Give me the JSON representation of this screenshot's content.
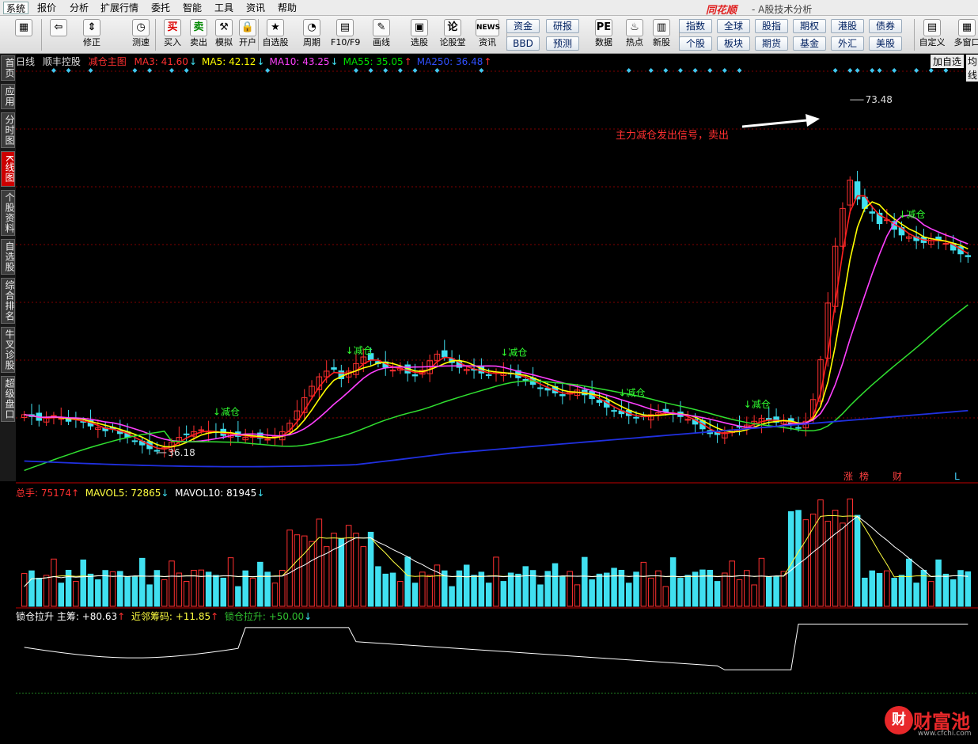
{
  "menu": {
    "items": [
      "系统",
      "报价",
      "分析",
      "扩展行情",
      "委托",
      "智能",
      "工具",
      "资讯",
      "帮助"
    ],
    "brand": "同花顺",
    "subtitle": "- A股技术分析"
  },
  "toolbar": {
    "buttons": [
      {
        "label": "",
        "icon": "grid-icon"
      },
      {
        "label": "",
        "icon": "back-arrow-icon"
      },
      {
        "label": "修正",
        "icon": "updown-arrow-icon"
      },
      {
        "label": "测速",
        "icon": "clock-icon"
      },
      {
        "label": "买入",
        "icon": "buy-icon",
        "glyph": "买"
      },
      {
        "label": "卖出",
        "icon": "sell-icon",
        "glyph": "卖"
      },
      {
        "label": "模拟",
        "icon": "hammer-icon"
      },
      {
        "label": "开户",
        "icon": "lock-icon"
      },
      {
        "label": "自选股",
        "icon": "star-icon"
      },
      {
        "label": "周期",
        "icon": "cycle-icon"
      },
      {
        "label": "F10/F9",
        "icon": "f10-icon"
      },
      {
        "label": "画线",
        "icon": "pen-icon"
      },
      {
        "label": "选股",
        "icon": "monitor-icon"
      },
      {
        "label": "论股堂",
        "icon": "forum-icon"
      },
      {
        "label": "资讯",
        "icon": "news-icon",
        "glyph": "NEWS"
      },
      {
        "label": "数据",
        "icon": "pe-icon",
        "glyph": "PE"
      },
      {
        "label": "热点",
        "icon": "hot-icon"
      },
      {
        "label": "新股",
        "icon": "ipo-icon"
      },
      {
        "label": "自定义",
        "icon": "custom-icon"
      },
      {
        "label": "多窗口",
        "icon": "multiwindow-icon"
      }
    ],
    "grid_buttons": [
      "资金",
      "研报",
      "BBD",
      "预测",
      "指数",
      "全球",
      "股指",
      "期权",
      "港股",
      "债券",
      "个股",
      "板块",
      "期货",
      "基金",
      "外汇",
      "美股"
    ]
  },
  "sidebar": {
    "tabs": [
      "首页",
      "应用",
      "分时图",
      "K线图",
      "个股资料",
      "自选股",
      "综合排名",
      "牛叉诊股",
      "超级盘口"
    ],
    "active": 3
  },
  "price_panel": {
    "period": "日线",
    "stock": "顺丰控股",
    "mode": "减仓主图",
    "ma": [
      {
        "name": "MA3",
        "value": "41.60",
        "arrow": "↓",
        "color": "#ff3030"
      },
      {
        "name": "MA5",
        "value": "42.12",
        "arrow": "↓",
        "color": "#ffff00"
      },
      {
        "name": "MA10",
        "value": "43.25",
        "arrow": "↓",
        "color": "#ff40ff"
      },
      {
        "name": "MA55",
        "value": "35.05",
        "arrow": "↑",
        "color": "#00e000"
      },
      {
        "name": "MA250",
        "value": "36.48",
        "arrow": "↑",
        "color": "#3050ff"
      }
    ],
    "add_select": "加自选",
    "avg_tab": "均线",
    "high_label": "73.48",
    "low_label": "36.18",
    "signal_text": "↓减仓",
    "annotation": "主力减仓发出信号，卖出",
    "event_flags": [
      "涨",
      "榜",
      "财",
      "L"
    ]
  },
  "volume_panel": {
    "label": "总手",
    "value": "75174",
    "arrow": "↑",
    "mavol5_label": "MAVOL5",
    "mavol5": "72865",
    "mavol5_arrow": "↓",
    "mavol10_label": "MAVOL10",
    "mavol10": "81945",
    "mavol10_arrow": "↓"
  },
  "indicator_panel": {
    "name": "锁仓拉升",
    "main_label": "主筹",
    "main": "+80.63",
    "main_arrow": "↑",
    "near_label": "近邻筹码",
    "near": "+11.85",
    "near_arrow": "↑",
    "lock_label": "锁仓拉升",
    "lock": "+50.00",
    "lock_arrow": "↓"
  },
  "watermark": {
    "name": "财富池",
    "url": "www.cfchi.com",
    "glyph": "财"
  },
  "colors": {
    "up": "#ff3030",
    "down": "#40e0f0",
    "ma3": "#ff2020",
    "ma5": "#ffff00",
    "ma10": "#ff40ff",
    "ma55": "#30e030",
    "ma250": "#2030e0",
    "signal": "#30ff30"
  },
  "chart_data": {
    "type": "candlestick",
    "stock": "顺丰控股",
    "ylim": [
      34,
      75
    ],
    "close": [
      40.2,
      40.0,
      39.6,
      39.9,
      40.1,
      39.8,
      39.5,
      39.7,
      39.4,
      39.0,
      38.8,
      38.5,
      38.7,
      38.2,
      37.8,
      37.4,
      37.0,
      36.6,
      36.4,
      36.7,
      37.3,
      37.8,
      38.1,
      38.4,
      38.6,
      38.4,
      38.3,
      38.0,
      38.2,
      37.9,
      37.8,
      37.9,
      37.7,
      37.6,
      37.9,
      38.4,
      39.3,
      40.6,
      42.0,
      43.2,
      44.2,
      44.8,
      45.0,
      44.0,
      44.8,
      45.6,
      46.3,
      46.0,
      45.6,
      45.2,
      44.9,
      45.1,
      44.6,
      44.3,
      44.9,
      45.9,
      46.6,
      46.3,
      45.7,
      45.2,
      45.0,
      44.9,
      44.6,
      44.4,
      44.7,
      44.6,
      44.5,
      44.1,
      43.9,
      43.4,
      43.0,
      42.8,
      42.5,
      42.2,
      42.6,
      42.8,
      42.3,
      41.9,
      41.5,
      41.0,
      40.6,
      40.3,
      40.1,
      39.9,
      40.0,
      40.2,
      40.4,
      40.5,
      40.3,
      40.0,
      39.7,
      39.2,
      38.7,
      38.2,
      38.1,
      38.3,
      38.6,
      38.9,
      39.1,
      39.5,
      39.8,
      39.6,
      39.4,
      39.6,
      39.2,
      38.8,
      39.5,
      41.8,
      46.0,
      52.0,
      58.0,
      62.0,
      65.0,
      63.0,
      62.0,
      61.5,
      60.4,
      60.8,
      59.8,
      59.2,
      59.0,
      58.6,
      58.4,
      58.8,
      58.6,
      58.3,
      57.6,
      57.2,
      56.9
    ],
    "high_marker": 73.48,
    "low_marker": 36.18,
    "signals": [
      26,
      44,
      65,
      81,
      98,
      119
    ],
    "ma55_start": 34.3,
    "ma250_start": 35.3
  }
}
